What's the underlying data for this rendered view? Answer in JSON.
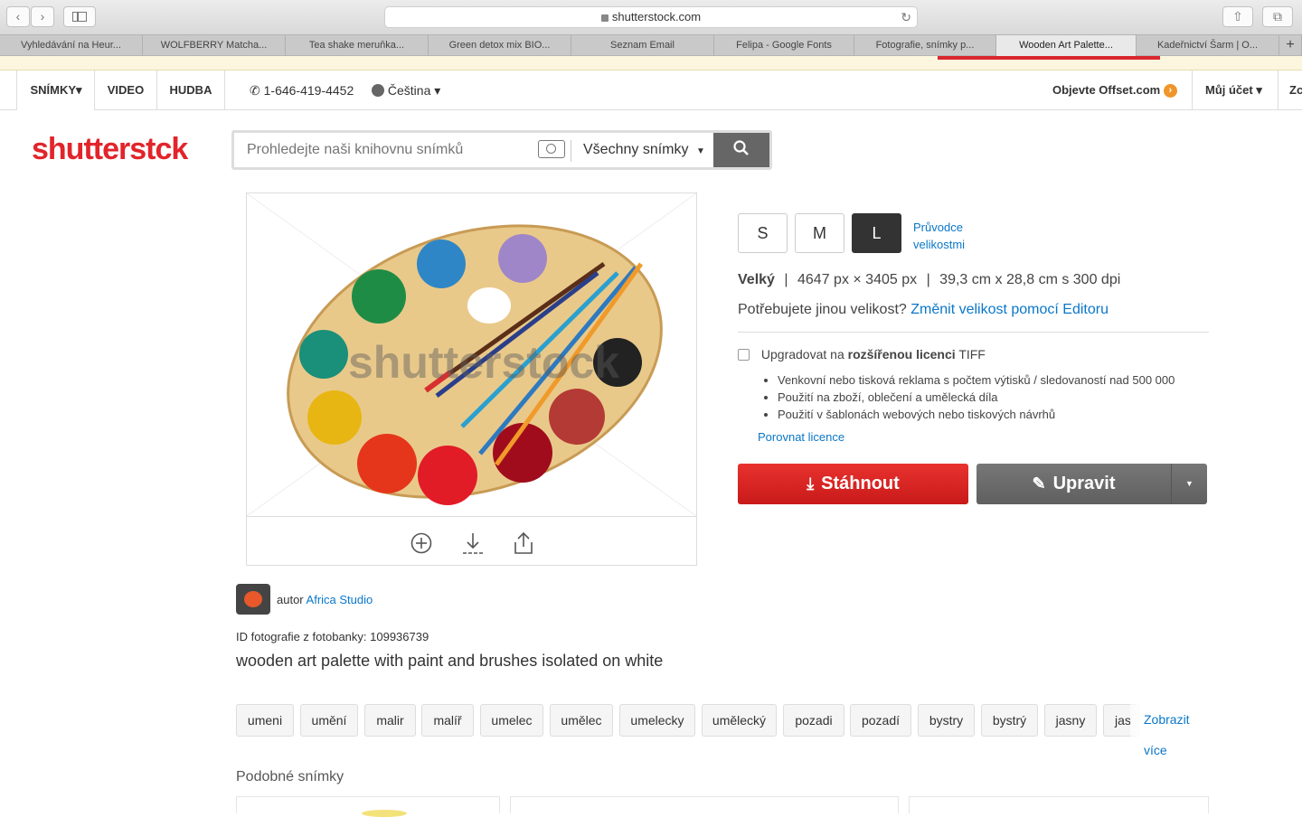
{
  "browser": {
    "url": "shutterstock.com",
    "tabs": [
      "Vyhledávání na Heur...",
      "WOLFBERRY Matcha...",
      "Tea shake meruňka...",
      "Green detox mix BIO...",
      "Seznam Email",
      "Felipa - Google Fonts",
      "Fotografie, snímky p...",
      "Wooden Art Palette...",
      "Kadeřnictví Šarm | O..."
    ],
    "new_tab": "+"
  },
  "topnav": {
    "snimky": "SNÍMKY▾",
    "video": "VIDEO",
    "hudba": "HUDBA",
    "phone": "1-646-419-4452",
    "language": "Čeština ▾",
    "offset": "Objevte Offset.com",
    "account": "Můj účet ▾",
    "cut": "Zc"
  },
  "logo": {
    "text_a": "shutterst",
    "text_b": "ck"
  },
  "search": {
    "placeholder": "Prohledejte naši knihovnu snímků",
    "category": "Všechny snímky"
  },
  "image": {
    "watermark": "shutterstock",
    "author_prefix": "autor",
    "author": "Africa Studio",
    "id_line": "ID fotografie z fotobanky: 109936739",
    "title": "wooden art palette with paint and brushes isolated on white"
  },
  "sizes": {
    "options": [
      "S",
      "M",
      "L"
    ],
    "selected": "L",
    "guide_line1": "Průvodce",
    "guide_line2": "velikostmi",
    "name": "Velký",
    "px": "4647 px × 3405 px",
    "cm": "39,3 cm x 28,8 cm s 300 dpi",
    "other_q": "Potřebujete jinou velikost?",
    "other_link": "Změnit velikost pomocí Editoru"
  },
  "license": {
    "prefix": "Upgradovat na",
    "bold": "rozšířenou licenci",
    "suffix": "TIFF",
    "bullets": [
      "Venkovní nebo tisková reklama s počtem výtisků / sledovaností nad 500 000",
      "Použití na zboží, oblečení a umělecká díla",
      "Použití v šablonách webových nebo tiskových návrhů"
    ],
    "compare": "Porovnat licence"
  },
  "actions": {
    "download": "Stáhnout",
    "edit": "Upravit"
  },
  "tags": [
    "umeni",
    "umění",
    "malir",
    "malíř",
    "umelec",
    "umělec",
    "umelecky",
    "umělecký",
    "pozadi",
    "pozadí",
    "bystry",
    "bystrý",
    "jasny",
    "jas"
  ],
  "more_tags": "Zobrazit více",
  "similar_heading": "Podobné snímky",
  "colors": {
    "brand_red": "#e2242b",
    "link_blue": "#0a77c9",
    "edit_gray": "#6b6b6b"
  }
}
